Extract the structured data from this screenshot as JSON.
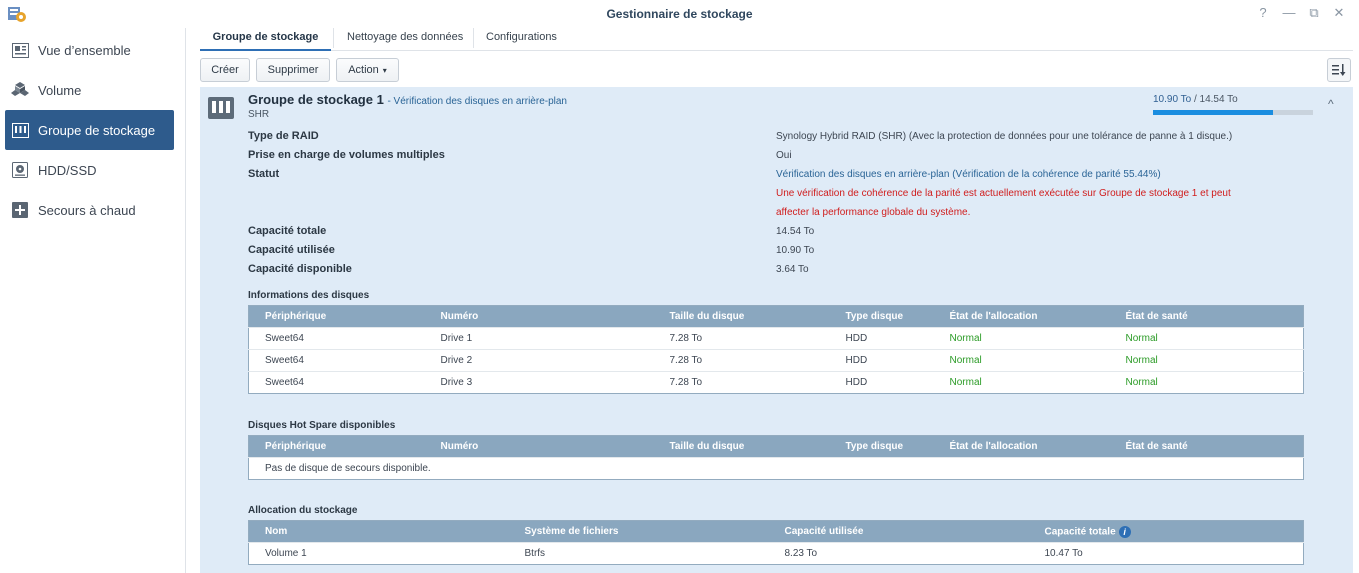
{
  "window": {
    "title": "Gestionnaire de stockage",
    "help_glyph": "?",
    "minimize_glyph": "—",
    "restore_glyph": "⧉",
    "close_glyph": "✕"
  },
  "sidebar": {
    "items": [
      {
        "label": "Vue d’ensemble",
        "icon": "overview-icon"
      },
      {
        "label": "Volume",
        "icon": "volume-icon"
      },
      {
        "label": "Groupe de stockage",
        "icon": "storage-pool-icon",
        "active": true
      },
      {
        "label": "HDD/SSD",
        "icon": "hdd-icon"
      },
      {
        "label": "Secours à chaud",
        "icon": "hot-spare-icon"
      }
    ]
  },
  "tabs": [
    {
      "label": "Groupe de stockage",
      "active": true
    },
    {
      "label": "Nettoyage des données"
    },
    {
      "label": "Configurations"
    }
  ],
  "toolbar": {
    "create_label": "Créer",
    "delete_label": "Supprimer",
    "action_label": "Action",
    "action_caret": "▾"
  },
  "pool": {
    "title": "Groupe de stockage 1",
    "subtitle": "- Vérification des disques en arrière-plan",
    "type": "SHR",
    "used_capacity": "10.90 To",
    "separator": " / ",
    "total_capacity": "14.54 To",
    "usage_fraction": 0.75,
    "collapse_glyph": "^",
    "details": {
      "raid_label": "Type de RAID",
      "raid_value": "Synology Hybrid RAID (SHR) (Avec la protection de données pour une tolérance de panne à 1 disque.)",
      "multi_label": "Prise en charge de volumes multiples",
      "multi_value": "Oui",
      "status_label": "Statut",
      "status_value": "Vérification des disques en arrière-plan (Vérification de la cohérence de parité 55.44%)",
      "warning_line1": "Une vérification de cohérence de la parité est actuellement exécutée sur Groupe de stockage 1 et peut",
      "warning_line2": "affecter la performance globale du système.",
      "total_label": "Capacité totale",
      "total_value": "14.54 To",
      "used_label": "Capacité utilisée",
      "used_value": "10.90 To",
      "free_label": "Capacité disponible",
      "free_value": "3.64 To"
    }
  },
  "disks": {
    "title": "Informations des disques",
    "columns": [
      "Périphérique",
      "Numéro",
      "Taille du disque",
      "Type disque",
      "État de l'allocation",
      "État de santé"
    ],
    "rows": [
      [
        "Sweet64",
        "Drive 1",
        "7.28 To",
        "HDD",
        "Normal",
        "Normal"
      ],
      [
        "Sweet64",
        "Drive 2",
        "7.28 To",
        "HDD",
        "Normal",
        "Normal"
      ],
      [
        "Sweet64",
        "Drive 3",
        "7.28 To",
        "HDD",
        "Normal",
        "Normal"
      ]
    ]
  },
  "hotspare": {
    "title": "Disques Hot Spare disponibles",
    "columns": [
      "Périphérique",
      "Numéro",
      "Taille du disque",
      "Type disque",
      "État de l'allocation",
      "État de santé"
    ],
    "empty_text": "Pas de disque de secours disponible."
  },
  "allocation": {
    "title": "Allocation du stockage",
    "columns": [
      "Nom",
      "Système de fichiers",
      "Capacité utilisée",
      "Capacité totale"
    ],
    "rows": [
      [
        "Volume 1",
        "Btrfs",
        "8.23 To",
        "10.47 To"
      ]
    ]
  }
}
